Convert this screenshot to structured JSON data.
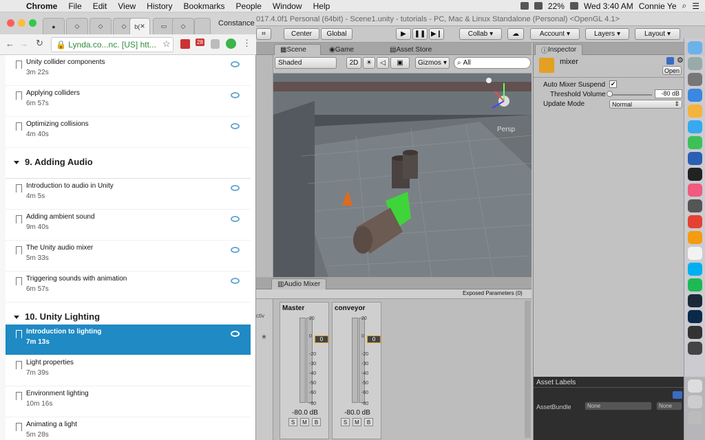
{
  "menubar": {
    "app": "Chrome",
    "items": [
      "File",
      "Edit",
      "View",
      "History",
      "Bookmarks",
      "People",
      "Window",
      "Help"
    ],
    "battery": "22%",
    "clock": "Wed 3:40 AM",
    "user": "Connie Ye"
  },
  "chrome": {
    "profile": "Constance",
    "url": "Lynda.co...nc. [US]  htt...",
    "active_tab_label": "b(",
    "badge": "28",
    "chapters": [
      {
        "index": 1,
        "title": "9. Adding Audio"
      },
      {
        "index": 2,
        "title": "10. Unity Lighting"
      }
    ],
    "items": [
      {
        "title": "Unity collider components",
        "duration": "3m 22s"
      },
      {
        "title": "Applying colliders",
        "duration": "6m 57s"
      },
      {
        "title": "Optimizing collisions",
        "duration": "4m 40s"
      },
      {
        "title": "Introduction to audio in Unity",
        "duration": "4m 5s"
      },
      {
        "title": "Adding ambient sound",
        "duration": "9m 40s"
      },
      {
        "title": "The Unity audio mixer",
        "duration": "5m 33s"
      },
      {
        "title": "Triggering sounds with animation",
        "duration": "6m 57s"
      },
      {
        "title": "Introduction to lighting",
        "duration": "7m 13s"
      },
      {
        "title": "Light properties",
        "duration": "7m 39s"
      },
      {
        "title": "Environment lighting",
        "duration": "10m 16s"
      },
      {
        "title": "Animating a light",
        "duration": "5m 28s"
      }
    ]
  },
  "unity": {
    "title": "017.4.0f1 Personal (64bit) - Scene1.unity - tutorials - PC, Mac & Linux Standalone (Personal) <OpenGL 4.1>",
    "toolbar": {
      "center": "Center",
      "global": "Global",
      "collab": "Collab",
      "account": "Account",
      "layers": "Layers",
      "layout": "Layout"
    },
    "tabs": {
      "scene": "Scene",
      "game": "Game",
      "asset_store": "Asset Store",
      "inspector": "Inspector",
      "audio_mixer": "Audio Mixer"
    },
    "scene_toolbar": {
      "shading": "Shaded",
      "mode2d": "2D",
      "gizmos": "Gizmos",
      "search": "All",
      "persp": "Persp"
    },
    "inspector": {
      "object_name": "mixer",
      "open_button": "Open",
      "auto_suspend_label": "Auto Mixer Suspend",
      "threshold_label": "Threshold Volume",
      "threshold_value": "-80 dB",
      "threshold_level": 0,
      "update_mode_label": "Update Mode",
      "update_mode_value": "Normal",
      "asset_labels": "Asset Labels",
      "assetbundle_label": "AssetBundle",
      "assetbundle_value": "None",
      "assetbundle_variant": "None"
    },
    "mixer": {
      "exposed_params": "Exposed Parameters (0)",
      "side_label": "ctiv",
      "strips": [
        {
          "name": "Master",
          "db": "-80.0 dB",
          "fader": "0"
        },
        {
          "name": "conveyor",
          "db": "-80.0 dB",
          "fader": "0"
        }
      ],
      "scale": [
        "20",
        "0",
        "-20",
        "-30",
        "-40",
        "-50",
        "-60",
        "-80"
      ],
      "buttons": [
        "S",
        "M",
        "B"
      ]
    }
  },
  "colors": {
    "accent": "#1f8ac4",
    "eye": "#6aa8d0",
    "green_url": "#2e8b3a"
  }
}
